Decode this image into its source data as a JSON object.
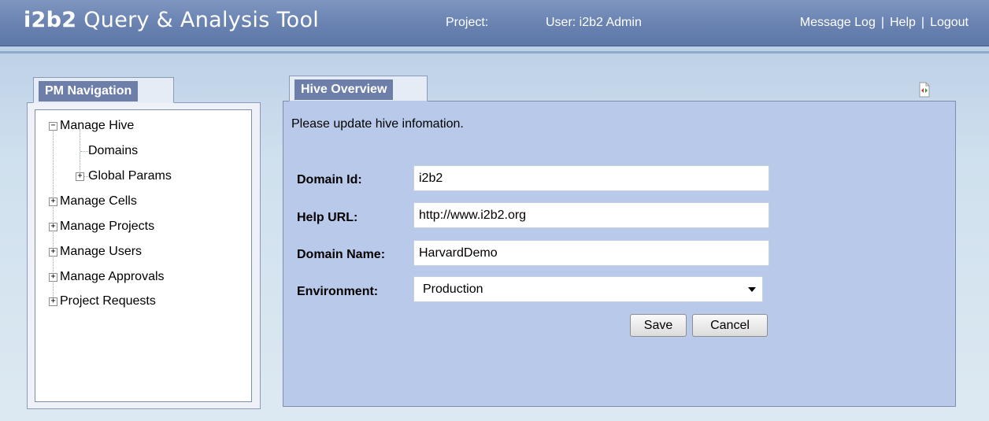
{
  "header": {
    "brand": "i2b2",
    "app_title": "Query & Analysis Tool",
    "project_label": "Project:",
    "user_label": "User: i2b2 Admin",
    "links": {
      "message_log": "Message Log",
      "help": "Help",
      "logout": "Logout",
      "separator": "|"
    }
  },
  "nav": {
    "tab_label": "PM Navigation",
    "items": {
      "manage_hive": "Manage Hive",
      "domains": "Domains",
      "global_params": "Global Params",
      "manage_cells": "Manage Cells",
      "manage_projects": "Manage Projects",
      "manage_users": "Manage Users",
      "manage_approvals": "Manage Approvals",
      "project_requests": "Project Requests"
    }
  },
  "hive": {
    "tab_label": "Hive Overview",
    "message": "Please update hive infomation.",
    "fields": {
      "domain_id": {
        "label": "Domain Id:",
        "value": "i2b2"
      },
      "help_url": {
        "label": "Help URL:",
        "value": "http://www.i2b2.org"
      },
      "domain_name": {
        "label": "Domain Name:",
        "value": "HarvardDemo"
      },
      "environment": {
        "label": "Environment:",
        "value": "Production"
      }
    },
    "buttons": {
      "save": "Save",
      "cancel": "Cancel"
    }
  },
  "colors": {
    "header_bg": "#6a83b1",
    "panel_bg": "#b9c9ea",
    "tab_bg": "#6d7fa8"
  }
}
